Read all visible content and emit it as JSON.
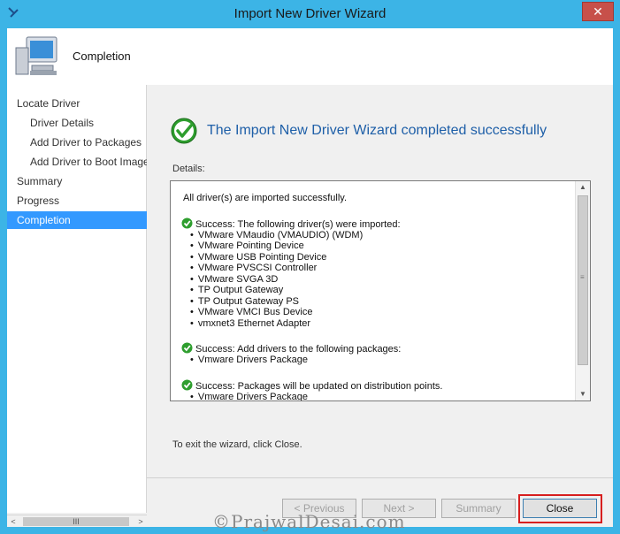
{
  "window": {
    "title": "Import New Driver Wizard",
    "close_glyph": "✕"
  },
  "header": {
    "page_title": "Completion"
  },
  "sidebar": {
    "items": [
      {
        "label": "Locate Driver",
        "level": 0,
        "selected": false
      },
      {
        "label": "Driver Details",
        "level": 1,
        "selected": false
      },
      {
        "label": "Add Driver to Packages",
        "level": 1,
        "selected": false
      },
      {
        "label": "Add Driver to Boot Images",
        "level": 1,
        "selected": false
      },
      {
        "label": "Summary",
        "level": 0,
        "selected": false
      },
      {
        "label": "Progress",
        "level": 0,
        "selected": false
      },
      {
        "label": "Completion",
        "level": 0,
        "selected": true
      }
    ],
    "scroll_left": "<",
    "scroll_thumb": "III",
    "scroll_right": ">"
  },
  "main": {
    "heading": "The Import New Driver Wizard completed successfully",
    "details_label": "Details:",
    "details": {
      "intro": "All driver(s) are imported successfully.",
      "sections": [
        {
          "title": "Success: The following driver(s) were imported:",
          "items": [
            "VMware VMaudio (VMAUDIO) (WDM)",
            "VMware Pointing Device",
            "VMware USB Pointing Device",
            "VMware PVSCSI Controller",
            "VMware SVGA 3D",
            "TP Output Gateway",
            "TP Output Gateway PS",
            "VMware VMCI Bus Device",
            "vmxnet3 Ethernet Adapter"
          ]
        },
        {
          "title": "Success: Add drivers to the following packages:",
          "items": [
            "Vmware Drivers Package"
          ]
        },
        {
          "title": "Success: Packages will be updated on distribution points.",
          "items": [
            "Vmware Drivers Package"
          ]
        }
      ]
    },
    "exit_text": "To exit the wizard, click Close."
  },
  "footer": {
    "previous_label": "< Previous",
    "next_label": "Next >",
    "summary_label": "Summary",
    "close_label": "Close"
  },
  "watermark": "©PrajwalDesai.com",
  "colors": {
    "titlebar": "#3cb4e6",
    "heading": "#1e5fa8",
    "selection": "#3399ff",
    "highlight": "#d71f1f",
    "success_green": "#2e9e2e"
  }
}
